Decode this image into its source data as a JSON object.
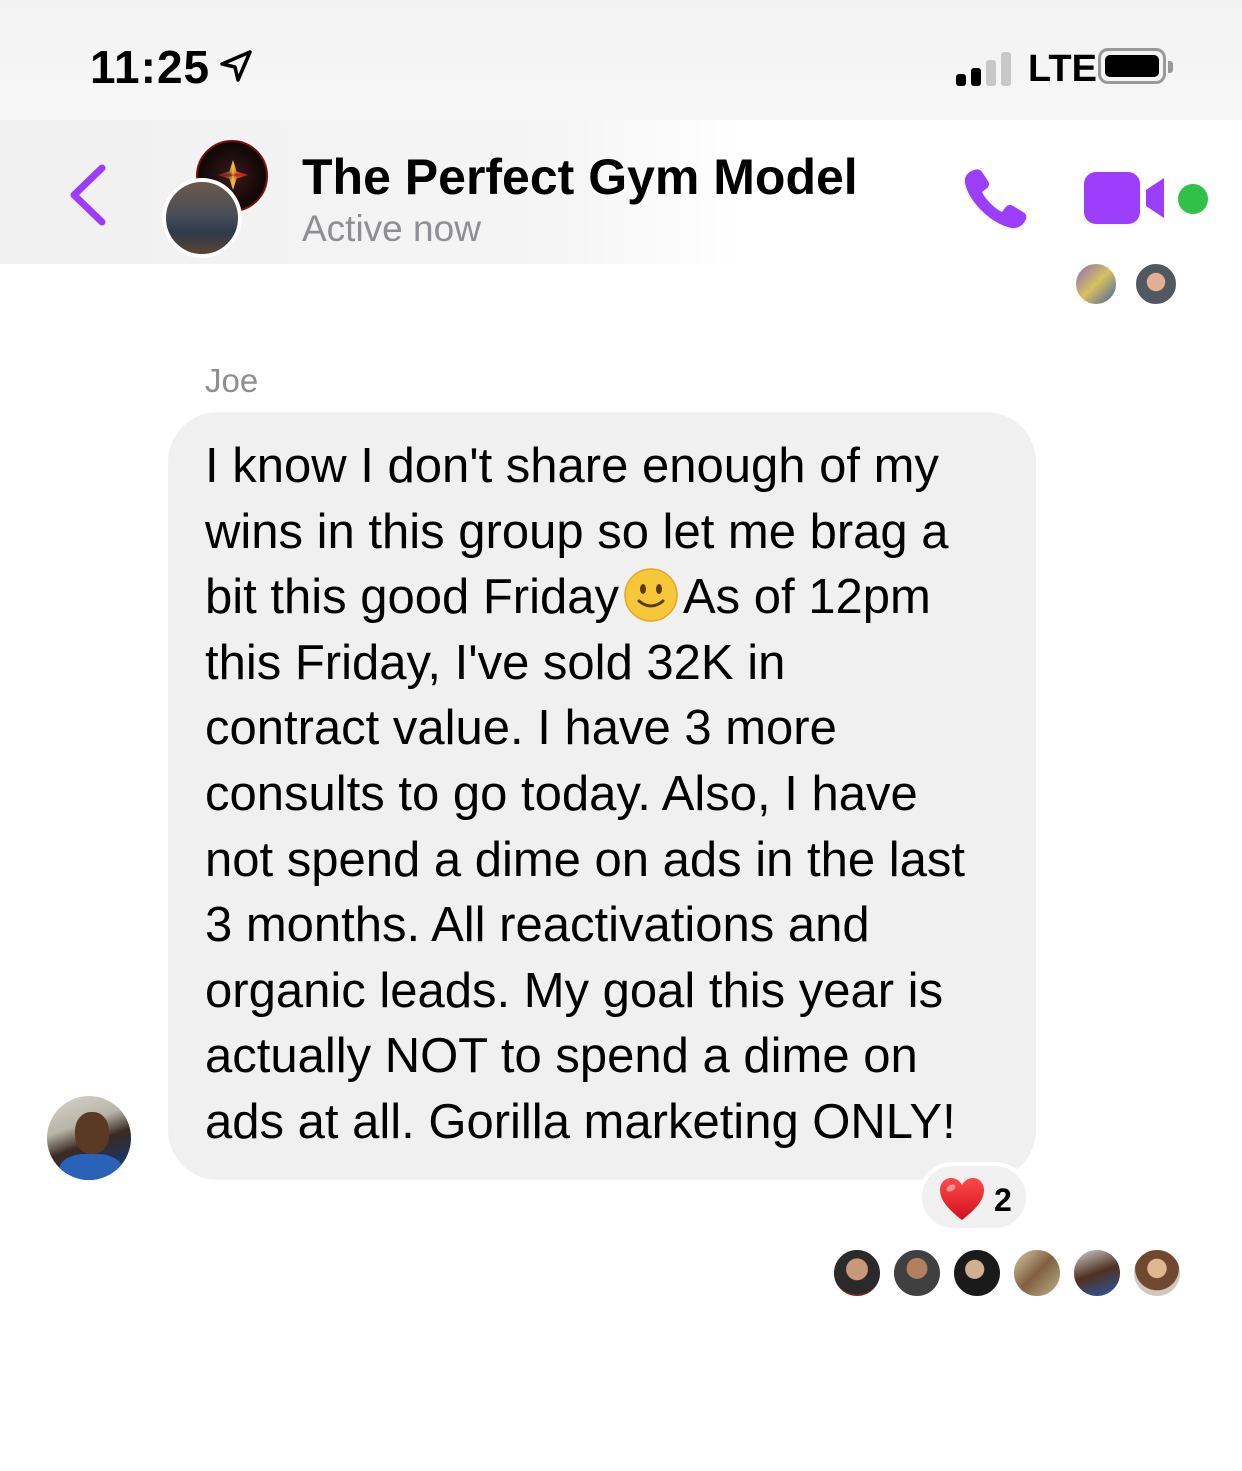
{
  "status_bar": {
    "time": "11:25",
    "network": "LTE",
    "location_icon": "location-arrow-icon",
    "signal_bars_active": 2,
    "signal_bars_total": 4
  },
  "header": {
    "title": "The Perfect Gym Model",
    "subtitle": "Active now",
    "back_icon": "chevron-left-icon",
    "call_icon": "phone-icon",
    "video_icon": "video-camera-icon",
    "accent_color": "#9b3dfa",
    "online_color": "#31c048"
  },
  "message": {
    "sender": "Joe",
    "lines": [
      "I know I don't share enough of my",
      "wins in this group so let me brag a",
      "As of 12pm",
      "this Friday, I've sold 32K in",
      "contract value. I have 3 more",
      "consults to go today. Also, I have",
      "not spend a dime on ads in the last",
      "3 months. All reactivations and",
      "organic leads. My goal this year is",
      "actually NOT to spend a dime on",
      "ads at all. Gorilla marketing ONLY!"
    ],
    "line3_before_emoji": "bit this good Friday",
    "emoji": "slightly-smiling-face-icon",
    "bubble_color": "#f0f0f0"
  },
  "reaction": {
    "icon": "heart-icon",
    "count": "2"
  },
  "read_receipts": {
    "top_count": 2,
    "bottom_count": 6
  }
}
